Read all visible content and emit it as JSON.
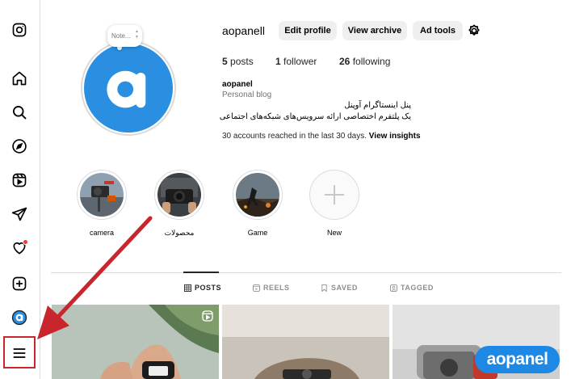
{
  "sidebar": {
    "items": [
      {
        "name": "instagram-logo-icon"
      },
      {
        "name": "home-icon"
      },
      {
        "name": "search-icon"
      },
      {
        "name": "explore-icon"
      },
      {
        "name": "reels-icon"
      },
      {
        "name": "direct-messages-icon"
      },
      {
        "name": "notifications-icon"
      },
      {
        "name": "create-icon"
      },
      {
        "name": "profile-avatar"
      },
      {
        "name": "more-menu-icon"
      }
    ]
  },
  "profile": {
    "note_placeholder": "Note...",
    "username": "aopanell",
    "buttons": {
      "edit": "Edit profile",
      "archive": "View archive",
      "ad_tools": "Ad tools"
    },
    "stats": {
      "posts_count": "5",
      "posts_label": "posts",
      "followers_count": "1",
      "followers_label": "follower",
      "following_count": "26",
      "following_label": "following"
    },
    "bio": {
      "name": "aopanel",
      "category": "Personal blog",
      "line1": "پنل اینستاگرام آوپنل",
      "line2": "یک پلتفرم اختصاصی ارائه سرویس‌های شبکه‌های اجتماعی"
    },
    "reach_text": "30 accounts reached in the last 30 days.",
    "reach_link": "View insights"
  },
  "highlights": [
    {
      "label": "camera"
    },
    {
      "label": "محصولات"
    },
    {
      "label": "Game"
    },
    {
      "label": "New"
    }
  ],
  "tabs": [
    {
      "label": "POSTS",
      "icon": "grid-icon",
      "active": true
    },
    {
      "label": "REELS",
      "icon": "reels-icon"
    },
    {
      "label": "SAVED",
      "icon": "bookmark-icon"
    },
    {
      "label": "TAGGED",
      "icon": "tag-icon"
    }
  ],
  "watermark": "aopanel",
  "colors": {
    "accent": "#0095f6",
    "brand_blue": "#2a8fe0",
    "annotation_red": "#c8262c",
    "notification_dot": "#ff3040"
  }
}
